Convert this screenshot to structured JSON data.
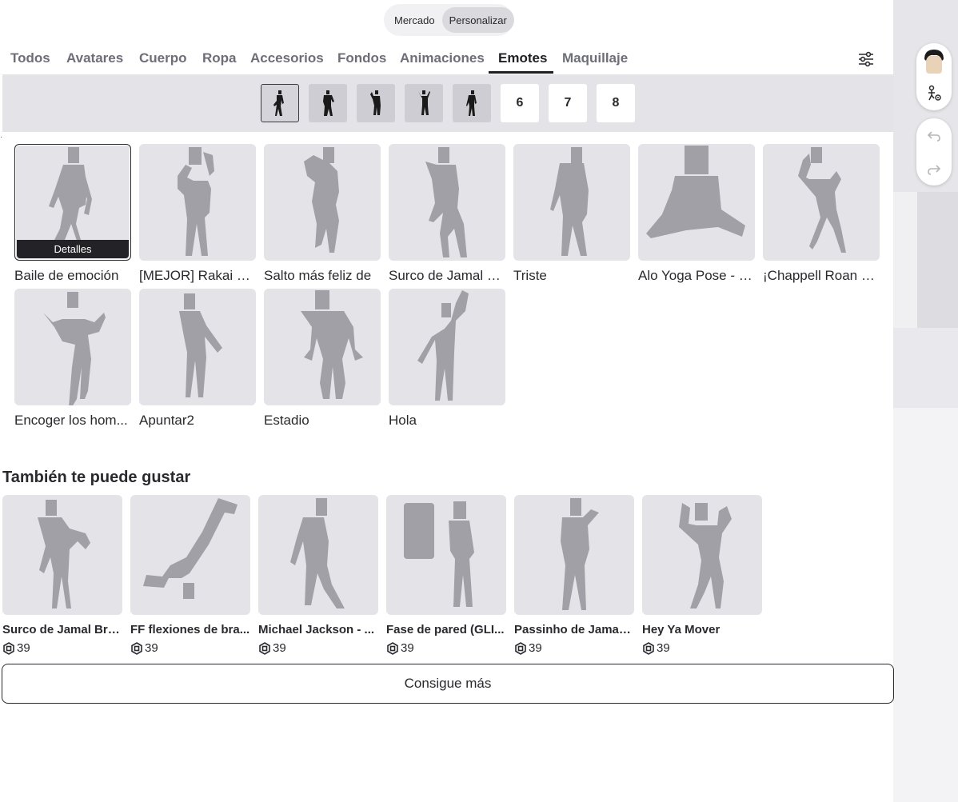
{
  "mode_toggle": {
    "options": [
      "Mercado",
      "Personalizar"
    ],
    "active": "Personalizar"
  },
  "tabs": [
    "Todos",
    "Avatares",
    "Cuerpo",
    "Ropa",
    "Accesorios",
    "Fondos",
    "Animaciones",
    "Emotes",
    "Maquillaje"
  ],
  "active_tab": "Emotes",
  "slots": {
    "filled_count": 5,
    "numbers": [
      "6",
      "7",
      "8"
    ],
    "selected_index": 0
  },
  "emotes": [
    {
      "name": "Baile de emoción",
      "selected": true,
      "details_label": "Detalles"
    },
    {
      "name": "[MEJOR] Rakai E..."
    },
    {
      "name": "Salto más feliz de"
    },
    {
      "name": "Surco de Jamal B..."
    },
    {
      "name": "Triste"
    },
    {
      "name": "Alo Yoga Pose - P..."
    },
    {
      "name": "¡Chappell Roan C..."
    },
    {
      "name": "Encoger los hom..."
    },
    {
      "name": "Apuntar2"
    },
    {
      "name": "Estadio"
    },
    {
      "name": "Hola"
    }
  ],
  "recommendations": {
    "title": "También te puede gustar",
    "items": [
      {
        "name": "Surco de Jamal Bra...",
        "price": "39"
      },
      {
        "name": "FF flexiones de bra...",
        "price": "39"
      },
      {
        "name": "Michael Jackson - ...",
        "price": "39"
      },
      {
        "name": "Fase de pared (GLI...",
        "price": "39"
      },
      {
        "name": "Passinho de Jamal ...",
        "price": "39"
      },
      {
        "name": "Hey Ya Mover",
        "price": "39"
      }
    ]
  },
  "get_more_label": "Consigue más",
  "icons": {
    "filter": "sliders-icon",
    "currency": "robux-icon",
    "undo": "undo-icon",
    "redo": "redo-icon",
    "avatar_settings": "avatar-settings-icon"
  },
  "colors": {
    "card_bg": "#e4e4e8",
    "figure": "#a0a0a6",
    "text": "#1f1f23",
    "muted": "#6e6e78"
  }
}
